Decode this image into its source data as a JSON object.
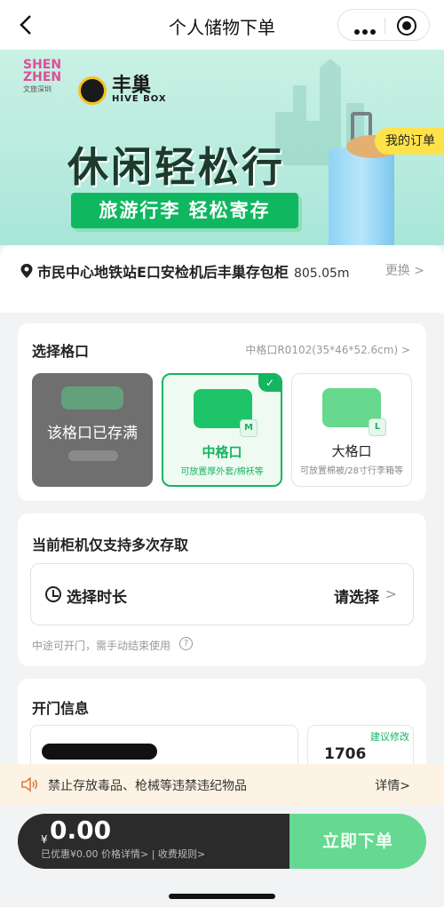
{
  "nav": {
    "title": "个人储物下单"
  },
  "banner": {
    "brand_left_1": "SHEN",
    "brand_left_2": "ZHEN",
    "brand_left_sub": "文旅深圳",
    "brand_right": "丰巢",
    "brand_right_sub": "HIVE BOX",
    "headline": "休闲轻松行",
    "tagline": "旅游行李  轻松寄存",
    "my_order": "我的订单"
  },
  "location": {
    "address": "市民中心地铁站E口安检机后丰巢存包柜",
    "distance": "805.05m",
    "change": "更换 >"
  },
  "compartment": {
    "title": "选择格口",
    "spec": "中格口R0102(35*46*52.6cm)  >",
    "options": [
      {
        "name": "该格口已存满",
        "desc": "",
        "state": "full"
      },
      {
        "name": "中格口",
        "badge": "M",
        "desc": "可放置厚外套/棉袄等",
        "state": "selected"
      },
      {
        "name": "大格口",
        "badge": "L",
        "desc": "可放置棉被/28寸行李箱等",
        "state": "available"
      }
    ]
  },
  "duration": {
    "title": "当前柜机仅支持多次存取",
    "label": "选择时长",
    "value": "请选择",
    "hint": "中途可开门，需手动结束使用",
    "help": "?"
  },
  "door": {
    "title": "开门信息",
    "suggest": "建议修改",
    "code": "1706"
  },
  "notice": {
    "message": "禁止存放毒品、枪械等违禁违纪物品",
    "details": "详情>"
  },
  "checkout": {
    "currency": "¥",
    "amount": "0.00",
    "sub": "已优惠¥0.00 价格详情> | 收费规则>",
    "button": "立即下单"
  },
  "colors": {
    "accent": "#14b560",
    "button_disabled": "#66d891",
    "dark": "#2b2b2b",
    "notice_bg": "#fdf3e4"
  }
}
